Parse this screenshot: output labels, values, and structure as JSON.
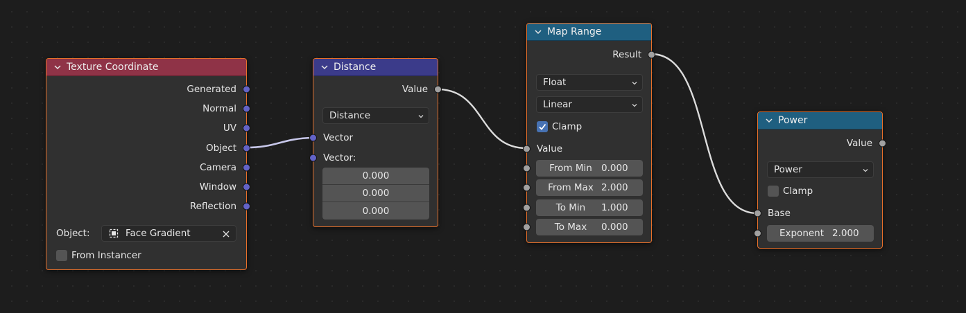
{
  "nodes": {
    "texture_coordinate": {
      "title": "Texture Coordinate",
      "outputs": [
        "Generated",
        "Normal",
        "UV",
        "Object",
        "Camera",
        "Window",
        "Reflection"
      ],
      "object_label": "Object:",
      "object_value": "Face Gradient",
      "from_instancer": "From Instancer",
      "from_instancer_checked": false,
      "header_color": "#8f3347"
    },
    "distance": {
      "title": "Distance",
      "output": "Value",
      "mode": "Distance",
      "input_1": "Vector",
      "input_2": "Vector:",
      "vector_values": [
        "0.000",
        "0.000",
        "0.000"
      ],
      "header_color": "#3b3b8a"
    },
    "map_range": {
      "title": "Map Range",
      "output": "Result",
      "data_type": "Float",
      "interpolation": "Linear",
      "clamp_label": "Clamp",
      "clamp_checked": true,
      "input_value": "Value",
      "params": [
        {
          "label": "From Min",
          "value": "0.000"
        },
        {
          "label": "From Max",
          "value": "2.000"
        },
        {
          "label": "To Min",
          "value": "1.000"
        },
        {
          "label": "To Max",
          "value": "0.000"
        }
      ],
      "header_color": "#1f5f80"
    },
    "power": {
      "title": "Power",
      "output": "Value",
      "operation": "Power",
      "clamp_label": "Clamp",
      "clamp_checked": false,
      "input_base": "Base",
      "exponent_label": "Exponent",
      "exponent_value": "2.000",
      "header_color": "#1f5f80"
    }
  },
  "colors": {
    "node_border": "#e8702a",
    "vector_socket": "#6363c7",
    "float_socket": "#a1a1a1",
    "checkbox_on": "#4772b3"
  }
}
